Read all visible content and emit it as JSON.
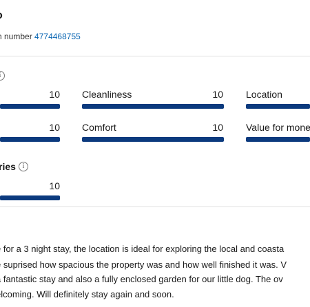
{
  "property": {
    "title_fragment": "o",
    "registration_prefix": "n number",
    "registration_number": "4774468755"
  },
  "ratings": {
    "rows": [
      [
        {
          "label": "",
          "score": "10",
          "fraction": 1.0
        },
        {
          "label": "Cleanliness",
          "score": "10",
          "fraction": 1.0
        },
        {
          "label": "Location",
          "score": "",
          "fraction": 1.0
        }
      ],
      [
        {
          "label": "",
          "score": "10",
          "fraction": 1.0
        },
        {
          "label": "Comfort",
          "score": "10",
          "fraction": 1.0
        },
        {
          "label": "Value for mone",
          "score": "",
          "fraction": 1.0
        }
      ]
    ]
  },
  "subratings": {
    "title_fragment": "ries",
    "score": "10",
    "fraction": 1.0
  },
  "review": {
    "lines": [
      "e for a 3 night stay, the location is ideal for exploring the local and coasta",
      "e suprised how spacious the property was and how well finished it was. V",
      "a fantastic stay and also a fully enclosed garden for our little dog. The ov",
      "elcoming. Will definitely stay again and soon."
    ]
  },
  "colors": {
    "bar_fill": "#0b3a7e",
    "link": "#0a66b3"
  },
  "icons": {
    "info": "info-circle-icon"
  }
}
